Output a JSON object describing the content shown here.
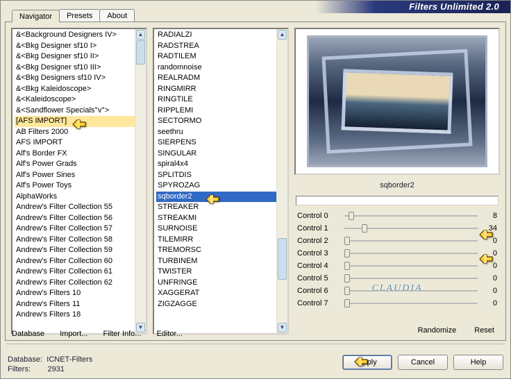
{
  "app_title": "Filters Unlimited 2.0",
  "tabs": [
    "Navigator",
    "Presets",
    "About"
  ],
  "active_tab": 0,
  "left_list": [
    "&<Background Designers IV>",
    "&<Bkg Designer sf10 I>",
    "&<Bkg Designer sf10 II>",
    "&<Bkg Designer sf10 III>",
    "&<Bkg Designers sf10 IV>",
    "&<Bkg Kaleidoscope>",
    "&<Kaleidoscope>",
    "&<Sandflower Specials°v°>",
    "[AFS IMPORT]",
    "AB Filters 2000",
    "AFS IMPORT",
    "Alf's Border FX",
    "Alf's Power Grads",
    "Alf's Power Sines",
    "Alf's Power Toys",
    "AlphaWorks",
    "Andrew's Filter Collection 55",
    "Andrew's Filter Collection 56",
    "Andrew's Filter Collection 57",
    "Andrew's Filter Collection 58",
    "Andrew's Filter Collection 59",
    "Andrew's Filter Collection 60",
    "Andrew's Filter Collection 61",
    "Andrew's Filter Collection 62",
    "Andrew's Filters 10",
    "Andrew's Filters 11",
    "Andrew's Filters 18"
  ],
  "left_selected_index": 8,
  "mid_list": [
    "RADIALZI",
    "RADSTREA",
    "RADTILEM",
    "randomnoise",
    "REALRADM",
    "RINGMIRR",
    "RINGTILE",
    "RIPPLEMI",
    "SECTORMO",
    "seethru",
    "SIERPENS",
    "SINGULAR",
    "spiral4x4",
    "SPLITDIS",
    "SPYROZAG",
    "sqborder2",
    "STREAKER",
    "STREAKMI",
    "SURNOISE",
    "TILEMIRR",
    "TREMORSC",
    "TURBINEM",
    "TWISTER",
    "UNFRINGE",
    "XAGGERAT",
    "ZIGZAGGE"
  ],
  "mid_selected_index": 15,
  "selected_filter": "sqborder2",
  "controls": [
    {
      "label": "Control 0",
      "value": 8,
      "pos": 3
    },
    {
      "label": "Control 1",
      "value": 34,
      "pos": 13
    },
    {
      "label": "Control 2",
      "value": 0,
      "pos": 0
    },
    {
      "label": "Control 3",
      "value": 0,
      "pos": 0
    },
    {
      "label": "Control 4",
      "value": 0,
      "pos": 0
    },
    {
      "label": "Control 5",
      "value": 0,
      "pos": 0
    },
    {
      "label": "Control 6",
      "value": 0,
      "pos": 0
    },
    {
      "label": "Control 7",
      "value": 0,
      "pos": 0
    }
  ],
  "bottom_links_left": [
    "Database",
    "Import...",
    "Filter Info...",
    "Editor..."
  ],
  "bottom_links_right": [
    "Randomize",
    "Reset"
  ],
  "footer": {
    "db_label": "Database:",
    "db_value": "ICNET-Filters",
    "filters_label": "Filters:",
    "filters_value": "2931"
  },
  "buttons": {
    "apply": "Apply",
    "cancel": "Cancel",
    "help": "Help"
  },
  "watermark": "CLAUDIA"
}
